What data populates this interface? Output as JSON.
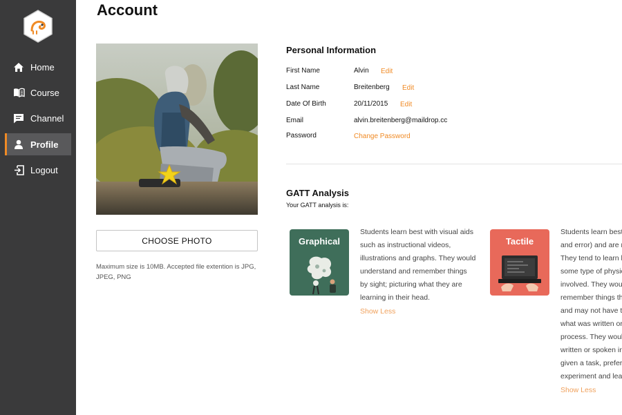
{
  "sidebar": {
    "logo_icon": "chameleon-hexagon-logo",
    "items": [
      {
        "label": "Home",
        "icon": "home-icon"
      },
      {
        "label": "Course",
        "icon": "book-icon"
      },
      {
        "label": "Channel",
        "icon": "chat-icon"
      },
      {
        "label": "Profile",
        "icon": "user-icon",
        "active": true
      },
      {
        "label": "Logout",
        "icon": "logout-icon"
      }
    ]
  },
  "page": {
    "title": "Account"
  },
  "photo_panel": {
    "button_label": "CHOOSE PHOTO",
    "note": "Maximum size is 10MB. Accepted file extention is JPG, JPEG, PNG"
  },
  "personal_info": {
    "title": "Personal Information",
    "fields": [
      {
        "label": "First Name",
        "value": "Alvin",
        "action": "Edit"
      },
      {
        "label": "Last Name",
        "value": "Breitenberg",
        "action": "Edit"
      },
      {
        "label": "Date Of Birth",
        "value": "20/11/2015",
        "action": "Edit"
      },
      {
        "label": "Email",
        "value": "alvin.breitenberg@maildrop.cc"
      },
      {
        "label": "Password",
        "action": "Change Password"
      }
    ]
  },
  "gatt": {
    "title": "GATT Analysis",
    "subtitle": "Your GATT analysis is:",
    "cards": [
      {
        "title": "Graphical",
        "color": "#3f6e5a",
        "lines": [
          "Students learn best with visual aids",
          "such as instructional videos,",
          "illustrations and graphs. They would",
          "understand and remember things",
          "by sight; picturing what they are",
          "learning in their head."
        ],
        "toggle": "Show Less"
      },
      {
        "title": "Tactile",
        "color": "#e8695a",
        "lines": [
          "Students learn best",
          "and error) and are m",
          "They tend to learn b",
          "some type of physic",
          "involved. They woul",
          "remember things th",
          "and may not have t",
          "what was written or",
          "process. They woul",
          "written or spoken in",
          "given a task, prefer",
          "experiment and lea"
        ],
        "toggle": "Show Less"
      }
    ]
  },
  "colors": {
    "accent": "#f08a24",
    "sidebar": "#3a3a3b"
  }
}
